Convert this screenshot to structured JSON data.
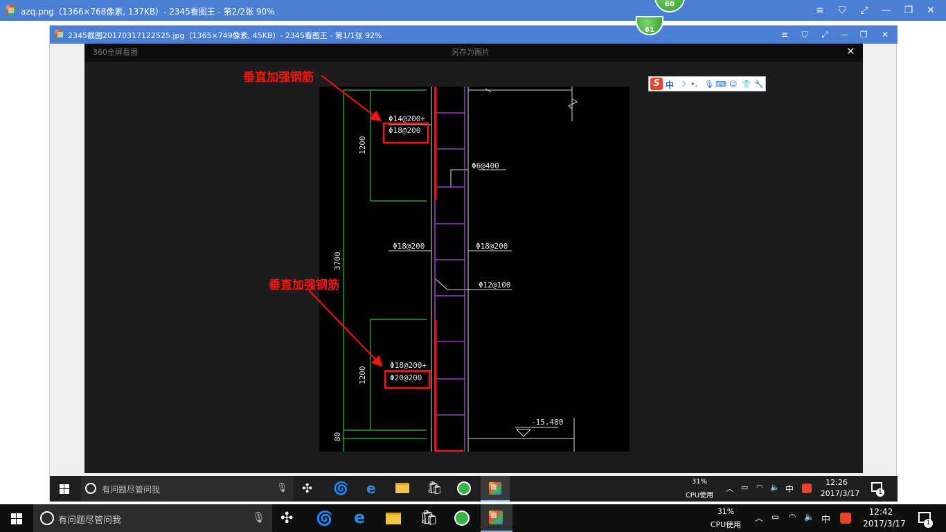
{
  "outer_window": {
    "title": "azq.png（1366×768像素, 137KB）- 2345看图王 - 第2/2张 90%",
    "badge": "60",
    "controls": [
      "menu-icon",
      "skin-icon",
      "fullscreen-icon",
      "minimize-icon",
      "restore-icon",
      "close-icon"
    ]
  },
  "inner_window": {
    "title": "2345截图20170317122525.jpg（1365×749像素, 45KB）- 2345看图王 - 第1/1张 92%",
    "badge": "61"
  },
  "viewer": {
    "top_left": "360全屏看图",
    "top_center": "另存为图片",
    "close": "✕"
  },
  "ime": {
    "logo": "S",
    "mode": "中"
  },
  "drawing": {
    "labels": [
      "Φ14@200+",
      "Φ18@200",
      "Φ6@400",
      "Φ18@200",
      "Φ18@200",
      "Φ12@100",
      "Φ18@200+",
      "Φ20@200",
      "-15.480"
    ],
    "dims": [
      "1200",
      "3700",
      "1200",
      "80"
    ]
  },
  "annotations": [
    "垂直加强钢筋",
    "垂直加强钢筋"
  ],
  "inner_taskbar": {
    "search_placeholder": "有问题尽管问我",
    "cpu_percent": "31%",
    "cpu_label": "CPU使用",
    "ime": "中",
    "time": "12:26",
    "date": "2017/3/17",
    "notify_count": "1"
  },
  "taskbar": {
    "search_placeholder": "有问题尽管问我",
    "cpu_percent": "31%",
    "cpu_label": "CPU使用",
    "ime": "中",
    "time": "12:42",
    "date": "2017/3/17",
    "notify_count": "1"
  },
  "colors": {
    "titlebar": "#4a7fd4",
    "annotation_red": "#ff1010",
    "cad_green": "#22c23a",
    "cad_purple": "#9b3cc7"
  }
}
